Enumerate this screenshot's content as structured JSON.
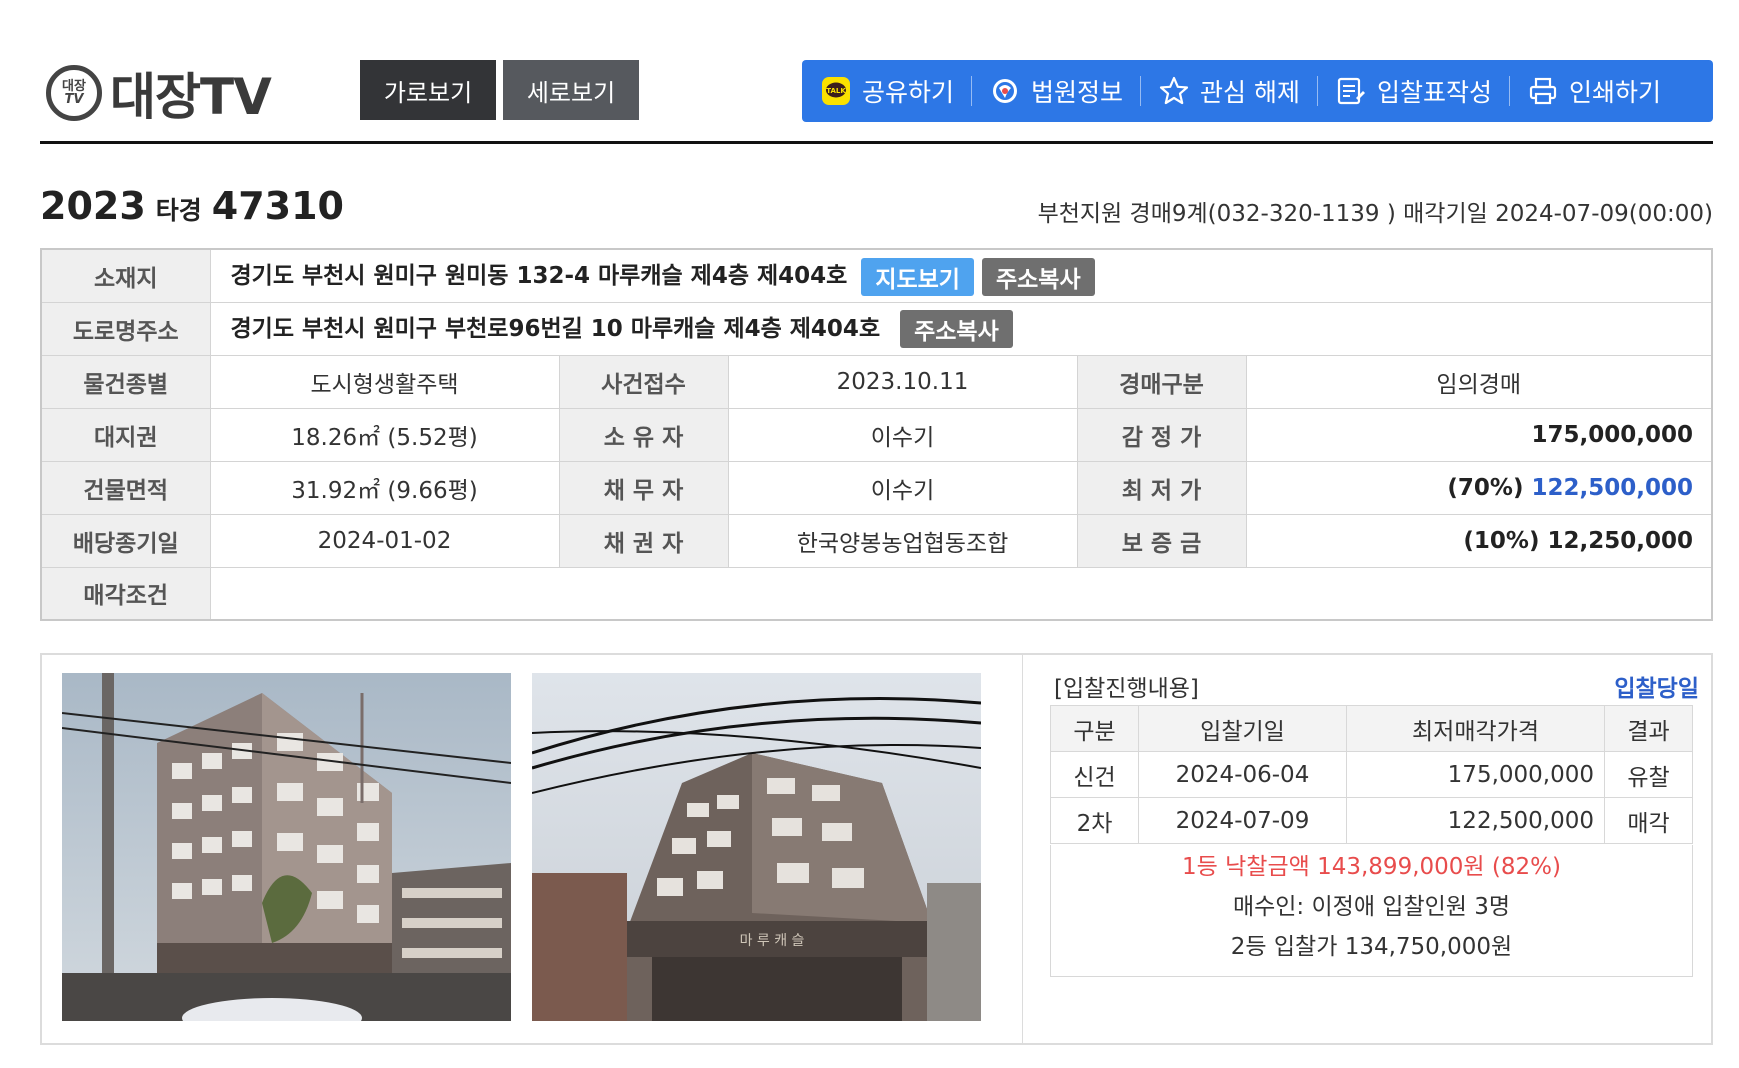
{
  "header": {
    "logo_seal_top": "대장",
    "logo_seal_bottom": "TV",
    "logo_text": "대장TV",
    "view_horizontal": "가로보기",
    "view_vertical": "세로보기",
    "toolbar": [
      {
        "label": "공유하기",
        "icon": "kakaotalk-icon"
      },
      {
        "label": "법원정보",
        "icon": "court-globe-icon"
      },
      {
        "label": "관심 해제",
        "icon": "star-icon"
      },
      {
        "label": "입찰표작성",
        "icon": "bid-form-icon"
      },
      {
        "label": "인쇄하기",
        "icon": "printer-icon"
      }
    ]
  },
  "case": {
    "year": "2023",
    "type": "타경",
    "number": "47310",
    "court_line": "부천지원 경매9계(032-320-1139 ) 매각기일 2024-07-09(00:00)"
  },
  "info": {
    "location_label": "소재지",
    "location": "경기도 부천시 원미구 원미동 132-4 마루캐슬 제4층 제404호",
    "map_button": "지도보기",
    "copy_button": "주소복사",
    "road_label": "도로명주소",
    "road_address": "경기도 부천시 원미구 부천로96번길 10 마루캐슬 제4층 제404호",
    "rows": [
      {
        "l1": "물건종별",
        "v1": "도시형생활주택",
        "l2": "사건접수",
        "v2": "2023.10.11",
        "l3": "경매구분",
        "v3": "임의경매"
      },
      {
        "l1": "대지권",
        "v1": "18.26㎡ (5.52평)",
        "l2": "소 유 자",
        "v2": "이수기",
        "l3": "감 정 가",
        "v3": "175,000,000"
      },
      {
        "l1": "건물면적",
        "v1": "31.92㎡ (9.66평)",
        "l2": "채 무 자",
        "v2": "이수기",
        "l3": "최 저 가",
        "v3_pct": "(70%)",
        "v3": "122,500,000"
      },
      {
        "l1": "배당종기일",
        "v1": "2024-01-02",
        "l2": "채 권 자",
        "v2": "한국양봉농업협동조합",
        "l3": "보 증 금",
        "v3": "(10%) 12,250,000"
      }
    ],
    "sale_condition_label": "매각조건",
    "sale_condition": ""
  },
  "bids": {
    "title": "[입찰진행내용]",
    "day_link": "입찰당일",
    "columns": [
      "구분",
      "입찰기일",
      "최저매각가격",
      "결과"
    ],
    "rows": [
      {
        "kind": "신건",
        "date": "2024-06-04",
        "price": "175,000,000",
        "result": "유찰"
      },
      {
        "kind": "2차",
        "date": "2024-07-09",
        "price": "122,500,000",
        "result": "매각"
      }
    ],
    "winning": "1등 낙찰금액 143,899,000원 (82%)",
    "buyer": "매수인: 이정애 입찰인원 3명",
    "second": "2등 입찰가 134,750,000원"
  },
  "colors": {
    "toolbar": "#2d77e6",
    "price_blue": "#2d5fc9",
    "sold_red": "#e84c4c",
    "map_button": "#4fa3ef"
  }
}
